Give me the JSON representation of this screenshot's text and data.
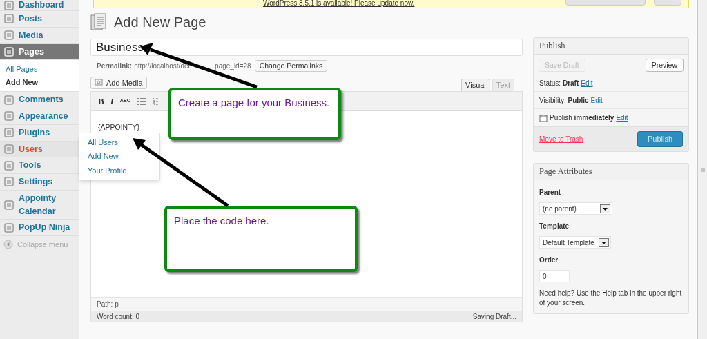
{
  "update_notice": {
    "text": "WordPress 3.5.1 is available! Please update now."
  },
  "sidebar": {
    "items": [
      {
        "label": "Dashboard",
        "selected": false,
        "hover": false
      },
      {
        "label": "Posts",
        "selected": false,
        "hover": false
      },
      {
        "label": "Media",
        "selected": false,
        "hover": false
      },
      {
        "label": "Pages",
        "selected": true,
        "hover": false,
        "children": [
          {
            "label": "All Pages",
            "selected": false
          },
          {
            "label": "Add New",
            "selected": true
          }
        ]
      },
      {
        "label": "Comments",
        "selected": false,
        "hover": false
      },
      {
        "label": "Appearance",
        "selected": false,
        "hover": false
      },
      {
        "label": "Plugins",
        "selected": false,
        "hover": false
      },
      {
        "label": "Users",
        "selected": false,
        "hover": true,
        "flyout": [
          "All Users",
          "Add New",
          "Your Profile"
        ]
      },
      {
        "label": "Tools",
        "selected": false,
        "hover": false
      },
      {
        "label": "Settings",
        "selected": false,
        "hover": false
      },
      {
        "label": "Appointy Calendar",
        "selected": false,
        "hover": false
      },
      {
        "label": "PopUp Ninja",
        "selected": false,
        "hover": false
      }
    ],
    "collapse": "Collapse menu"
  },
  "page_title": "Add New Page",
  "title_field": {
    "value": "Business"
  },
  "permalink": {
    "label": "Permalink:",
    "url_parts": [
      "http://localhost/dee",
      "page_id=28"
    ],
    "button": "Change Permalinks"
  },
  "add_media": "Add Media",
  "editor_tabs": [
    {
      "label": "Visual",
      "selected": true
    },
    {
      "label": "Text",
      "selected": false
    }
  ],
  "toolbar": [
    "B",
    "I",
    "ABC"
  ],
  "editor_content": "{APPOINTY}",
  "path": "Path: p",
  "word_count": "Word count: 0",
  "save_status": "Saving Draft...",
  "publish": {
    "title": "Publish",
    "save_draft": {
      "label": "Save Draft",
      "disabled": true
    },
    "preview": "Preview",
    "rows": [
      {
        "label": "Status:",
        "value": "Draft",
        "edit": "Edit"
      },
      {
        "label": "Visibility:",
        "value": "Public",
        "edit": "Edit"
      },
      {
        "label": "Publish",
        "value": "immediately",
        "edit": "Edit"
      }
    ],
    "trash": "Move to Trash",
    "publish_button": "Publish"
  },
  "page_attributes": {
    "title": "Page Attributes",
    "parent_label": "Parent",
    "parent": "(no parent)",
    "template_label": "Template",
    "template": "Default Template",
    "order_label": "Order",
    "order": "0",
    "help": "Need help? Use the Help tab in the upper right of your screen."
  },
  "callouts": [
    "Create a page for your Business.",
    "Place the code here."
  ]
}
